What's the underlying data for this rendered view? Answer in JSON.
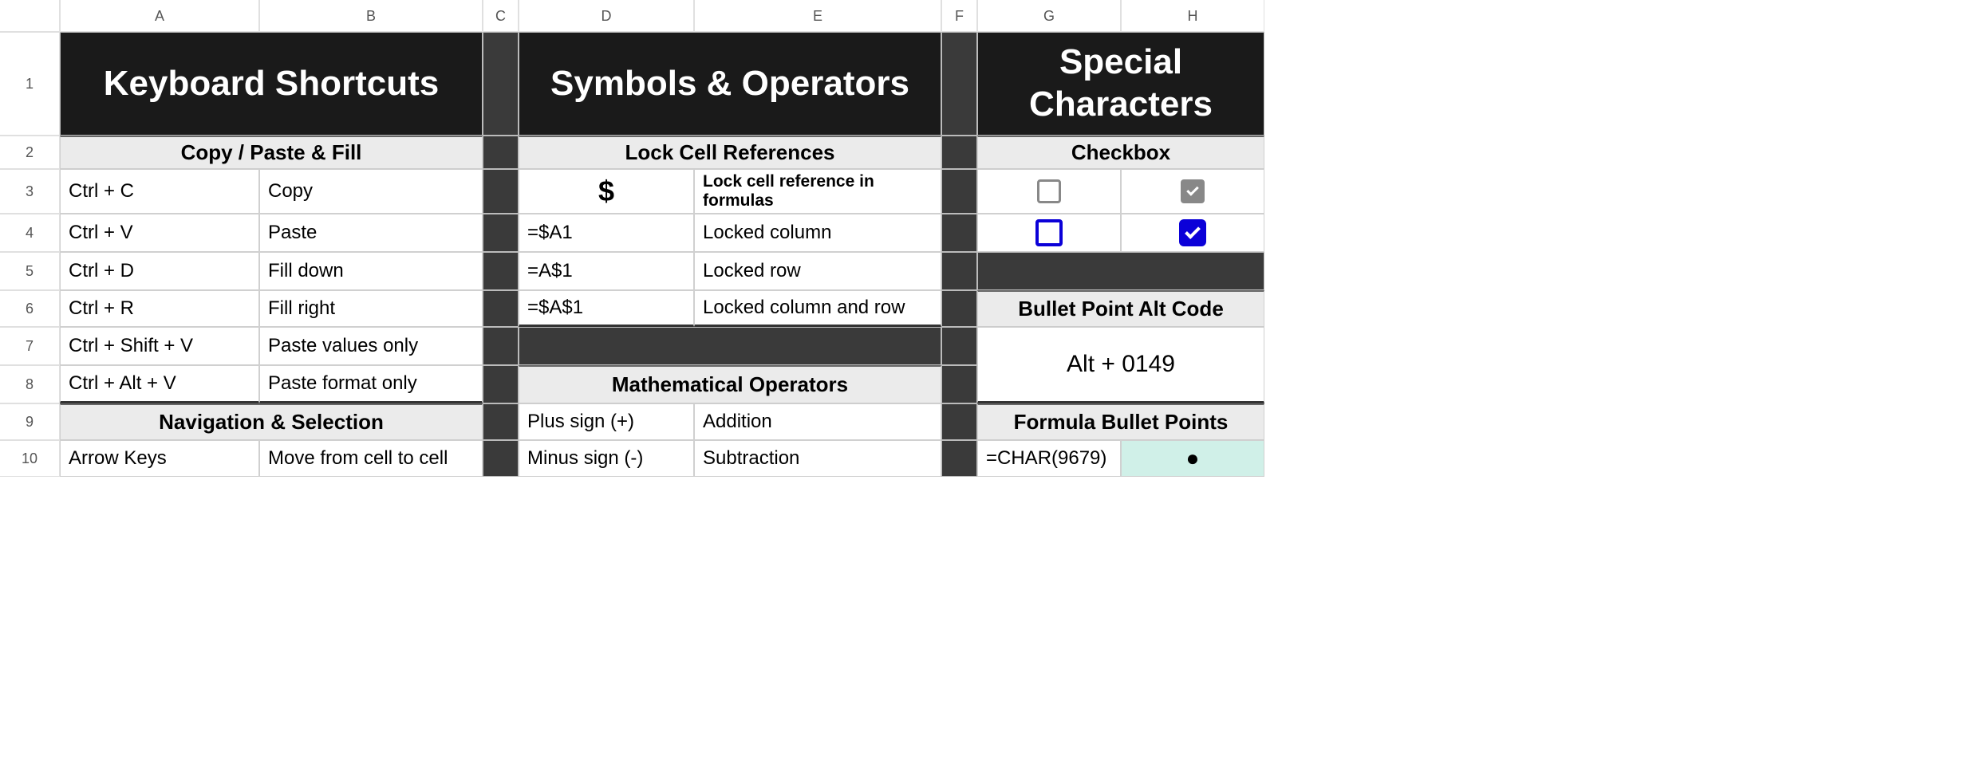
{
  "columns": [
    "A",
    "B",
    "C",
    "D",
    "E",
    "F",
    "G",
    "H"
  ],
  "rows": [
    "1",
    "2",
    "3",
    "4",
    "5",
    "6",
    "7",
    "8",
    "9",
    "10"
  ],
  "titles": {
    "AB": "Keyboard Shortcuts",
    "DE": "Symbols & Operators",
    "GH": "Special Characters"
  },
  "sections": {
    "copy_paste": "Copy / Paste & Fill",
    "navigation": "Navigation & Selection",
    "lock_refs": "Lock Cell References",
    "math_ops": "Mathematical Operators",
    "checkbox": "Checkbox",
    "bullet_alt": "Bullet Point Alt Code",
    "formula_bullets": "Formula Bullet Points"
  },
  "ab": {
    "r3": {
      "a": "Ctrl + C",
      "b": "Copy"
    },
    "r4": {
      "a": "Ctrl + V",
      "b": "Paste"
    },
    "r5": {
      "a": "Ctrl + D",
      "b": "Fill down"
    },
    "r6": {
      "a": "Ctrl + R",
      "b": "Fill right"
    },
    "r7": {
      "a": "Ctrl + Shift + V",
      "b": "Paste values only"
    },
    "r8": {
      "a": "Ctrl + Alt + V",
      "b": "Paste format only"
    },
    "r10": {
      "a": "Arrow Keys",
      "b": "Move from cell to cell"
    }
  },
  "de": {
    "r3": {
      "d": "$",
      "e": "Lock cell reference in formulas"
    },
    "r4": {
      "d": "=$A1",
      "e": "Locked column"
    },
    "r5": {
      "d": "=A$1",
      "e": "Locked row"
    },
    "r6": {
      "d": "=$A$1",
      "e": "Locked column and row"
    },
    "r9": {
      "d": "Plus sign (+)",
      "e": "Addition"
    },
    "r10": {
      "d": "Minus sign (-)",
      "e": "Subtraction"
    }
  },
  "gh": {
    "alt_code": "Alt + 0149",
    "r10": {
      "g": "=CHAR(9679)",
      "h": "●"
    }
  }
}
